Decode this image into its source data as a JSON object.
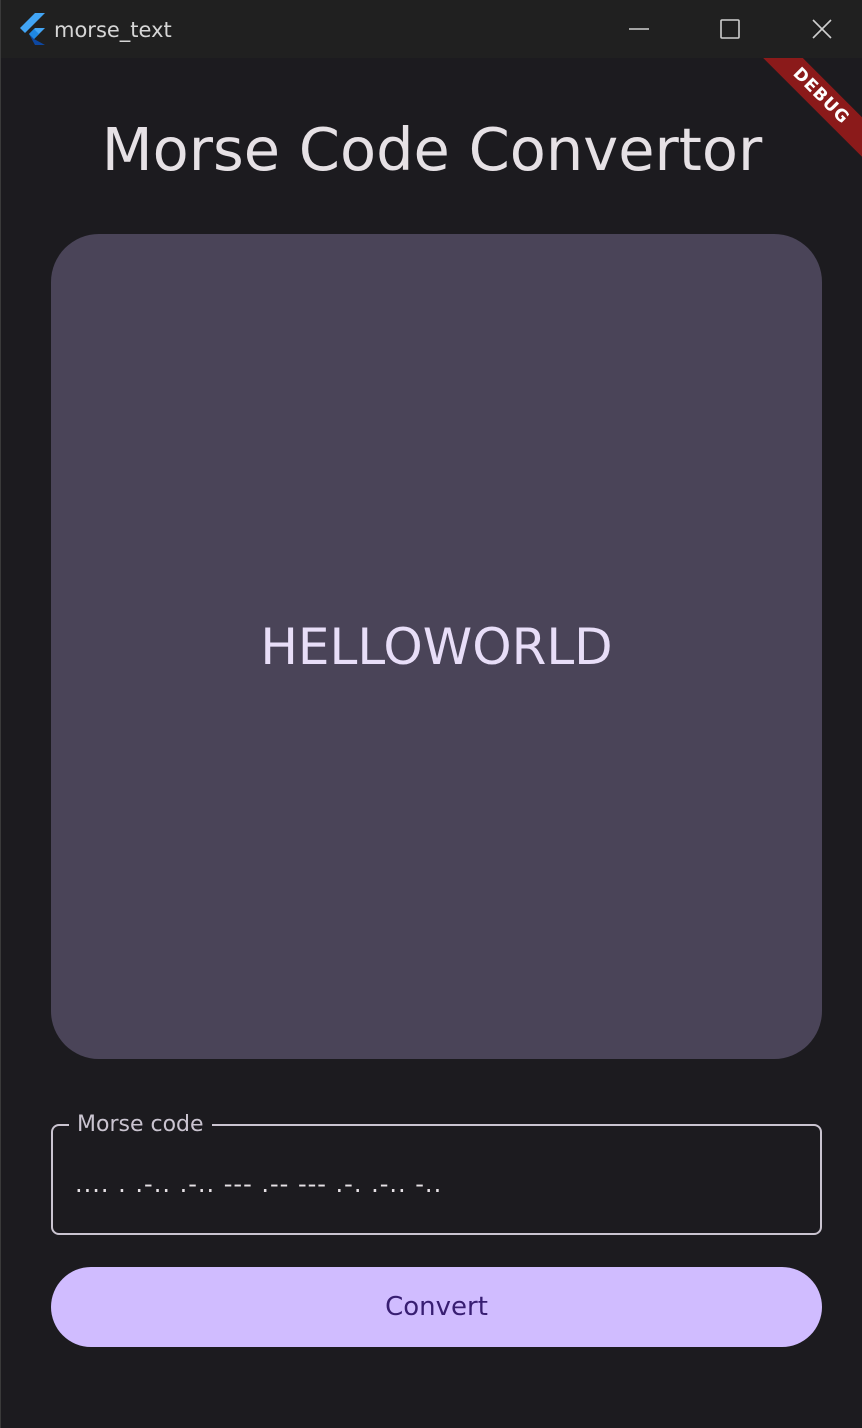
{
  "window": {
    "title": "morse_text"
  },
  "debug_banner": "DEBUG",
  "page": {
    "title": "Morse Code Convertor"
  },
  "output": {
    "text": "HELLOWORLD"
  },
  "input": {
    "label": "Morse code",
    "value": ".... . .-.. .-.. --- .-- --- .-. .-.. -.."
  },
  "button": {
    "label": "Convert"
  },
  "colors": {
    "background": "#1c1b1f",
    "card": "#4a4458",
    "accent": "#d0bcff",
    "debug": "#8b1a1a"
  },
  "icons": {
    "app": "flutter-logo-icon",
    "minimize": "minimize-icon",
    "maximize": "maximize-icon",
    "close": "close-icon"
  }
}
